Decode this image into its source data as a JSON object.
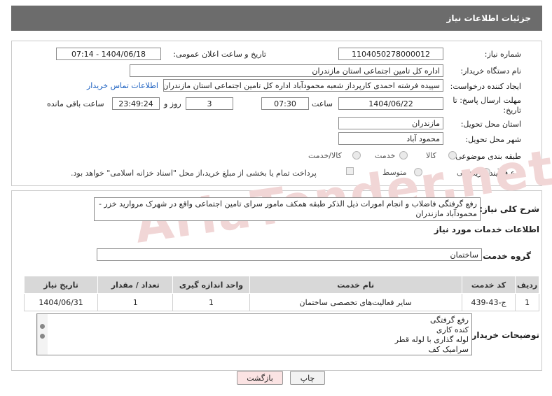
{
  "header": {
    "title": "جزئیات اطلاعات نیاز"
  },
  "fields": {
    "need_number_label": "شماره نیاز:",
    "need_number": "1104050278000012",
    "announce_label": "تاریخ و ساعت اعلان عمومی:",
    "announce_value": "1404/06/18 - 07:14",
    "buyer_org_label": "نام دستگاه خریدار:",
    "buyer_org": "اداره کل تامین اجتماعی استان مازندران",
    "requester_label": "ایجاد کننده درخواست:",
    "requester": "سپیده فرشته احمدی کارپرداز شعبه محمودآباد اداره کل تامین اجتماعی استان مازندران",
    "contact_link": "اطلاعات تماس خریدار",
    "deadline_label_1": "مهلت ارسال پاسخ: تا",
    "deadline_label_2": "تاریخ:",
    "deadline_date": "1404/06/22",
    "time_label": "ساعت",
    "deadline_time": "07:30",
    "days_value": "3",
    "days_label": "روز و",
    "remaining_time": "23:49:24",
    "remaining_label": "ساعت باقی مانده",
    "province_label": "استان محل تحویل:",
    "province": "مازندران",
    "city_label": "شهر محل تحویل:",
    "city": "محمود آباد",
    "category_label": "طبقه بندی موضوعی:",
    "category_options": [
      "کالا",
      "خدمت",
      "کالا/خدمت"
    ],
    "category_selected": "خدمت",
    "process_label": "نوع فرآیند خرید :",
    "process_options": [
      "جزیی",
      "متوسط"
    ],
    "process_selected": "جزیی",
    "process_note": "پرداخت تمام یا بخشی از مبلغ خرید،از محل \"اسناد خزانه اسلامی\" خواهد بود."
  },
  "summary": {
    "label": "شرح کلی نیاز:",
    "text": "رفع گرفتگی فاضلاب و انجام امورات ذیل الذکر طبقه همکف مامور سرای تامین اجتماعی واقع در شهرک مروارید خزر - محمودآباد مازندران"
  },
  "services": {
    "section_title": "اطلاعات خدمات مورد نیاز",
    "group_label": "گروه خدمت:",
    "group_value": "ساختمان",
    "columns": [
      "ردیف",
      "کد خدمت",
      "نام خدمت",
      "واحد اندازه گیری",
      "تعداد / مقدار",
      "تاریخ نیاز"
    ],
    "rows": [
      [
        "1",
        "ج-43-439",
        "سایر فعالیت‌های تخصصی ساختمان",
        "1",
        "1",
        "1404/06/31"
      ]
    ]
  },
  "buyer_notes": {
    "label": "توضیحات خریدار:",
    "lines": [
      "رفع گرفتگی",
      "کنده کاری",
      "لوله گذاری با لوله قطر",
      "سرامیک کف"
    ]
  },
  "buttons": {
    "print": "چاپ",
    "back": "بازگشت"
  },
  "watermark": "AriaTender.net"
}
